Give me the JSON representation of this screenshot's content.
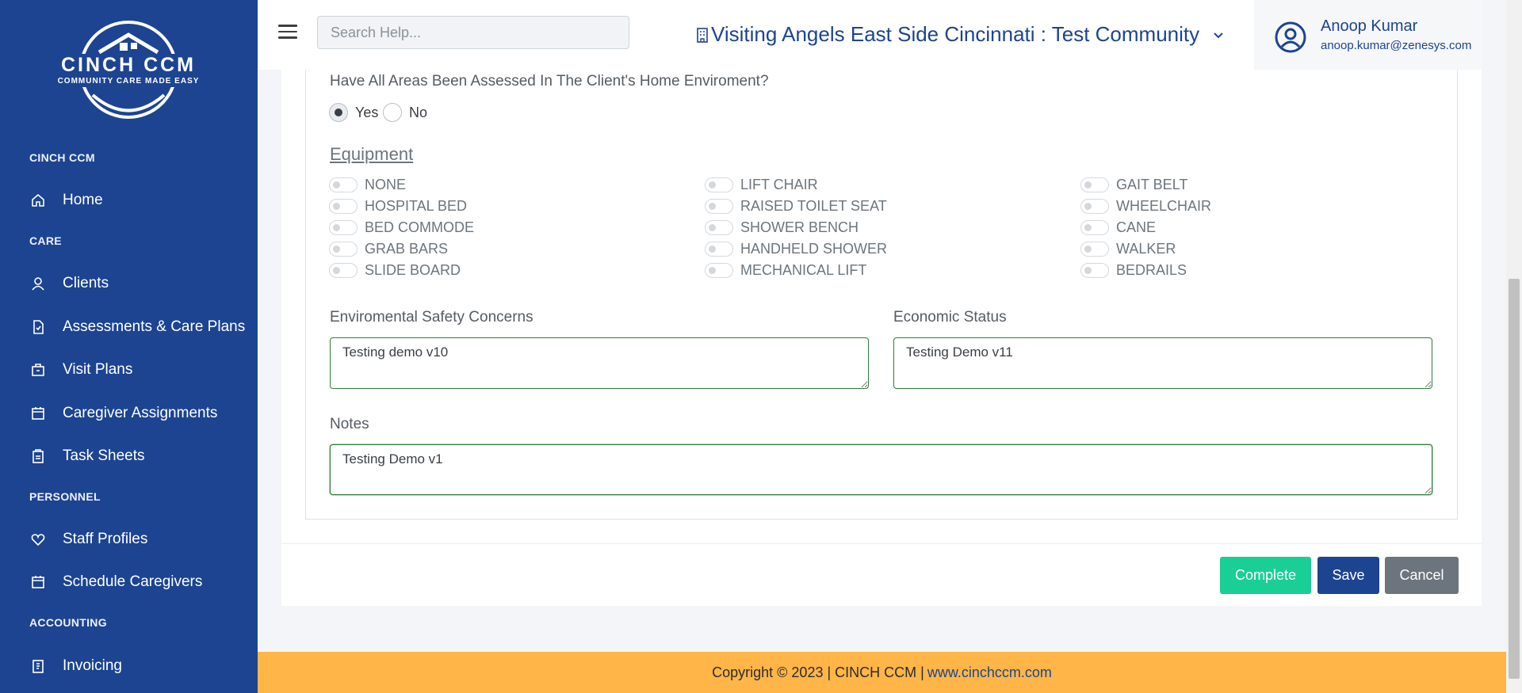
{
  "sidebar": {
    "logo": {
      "brand": "CINCH CCM",
      "tagline": "COMMUNITY CARE MADE EASY"
    },
    "sections": [
      {
        "title": "CINCH CCM",
        "items": [
          {
            "label": "Home",
            "icon": "home-icon"
          }
        ]
      },
      {
        "title": "CARE",
        "items": [
          {
            "label": "Clients",
            "icon": "user-icon"
          },
          {
            "label": "Assessments & Care Plans",
            "icon": "document-icon"
          },
          {
            "label": "Visit Plans",
            "icon": "briefcase-icon"
          },
          {
            "label": "Caregiver Assignments",
            "icon": "calendar-icon"
          },
          {
            "label": "Task Sheets",
            "icon": "clipboard-icon"
          }
        ]
      },
      {
        "title": "PERSONNEL",
        "items": [
          {
            "label": "Staff Profiles",
            "icon": "heart-icon"
          },
          {
            "label": "Schedule Caregivers",
            "icon": "calendar-icon"
          }
        ]
      },
      {
        "title": "ACCOUNTING",
        "items": [
          {
            "label": "Invoicing",
            "icon": "invoice-icon"
          }
        ]
      }
    ]
  },
  "header": {
    "search_placeholder": "Search Help...",
    "organization": "Visiting Angels East Side Cincinnati : Test Community",
    "user": {
      "name": "Anoop Kumar",
      "email": "anoop.kumar@zenesys.com"
    }
  },
  "form": {
    "question": "Have All Areas Been Assessed In The Client's Home Enviroment?",
    "options": [
      {
        "label": "Yes",
        "selected": true
      },
      {
        "label": "No",
        "selected": false
      }
    ],
    "equipment_title": "Equipment",
    "equipment": [
      [
        "NONE",
        "HOSPITAL BED",
        "BED COMMODE",
        "GRAB BARS",
        "SLIDE BOARD"
      ],
      [
        "LIFT CHAIR",
        "RAISED TOILET SEAT",
        "SHOWER BENCH",
        "HANDHELD SHOWER",
        "MECHANICAL LIFT"
      ],
      [
        "GAIT BELT",
        "WHEELCHAIR",
        "CANE",
        "WALKER",
        "BEDRAILS"
      ]
    ],
    "env_safety": {
      "label": "Enviromental Safety Concerns",
      "value": "Testing demo v10"
    },
    "economic_status": {
      "label": "Economic Status",
      "value": "Testing Demo v11"
    },
    "notes": {
      "label": "Notes",
      "value": "Testing Demo v1"
    },
    "buttons": {
      "complete": "Complete",
      "save": "Save",
      "cancel": "Cancel"
    }
  },
  "footer": {
    "text": "Copyright © 2023 | CINCH CCM |",
    "link": "www.cinchccm.com"
  },
  "colors": {
    "sidebar": "#1c4491",
    "primary": "#1c4491",
    "complete": "#19cf96",
    "cancel": "#6c757d",
    "footer": "#ffb547"
  }
}
